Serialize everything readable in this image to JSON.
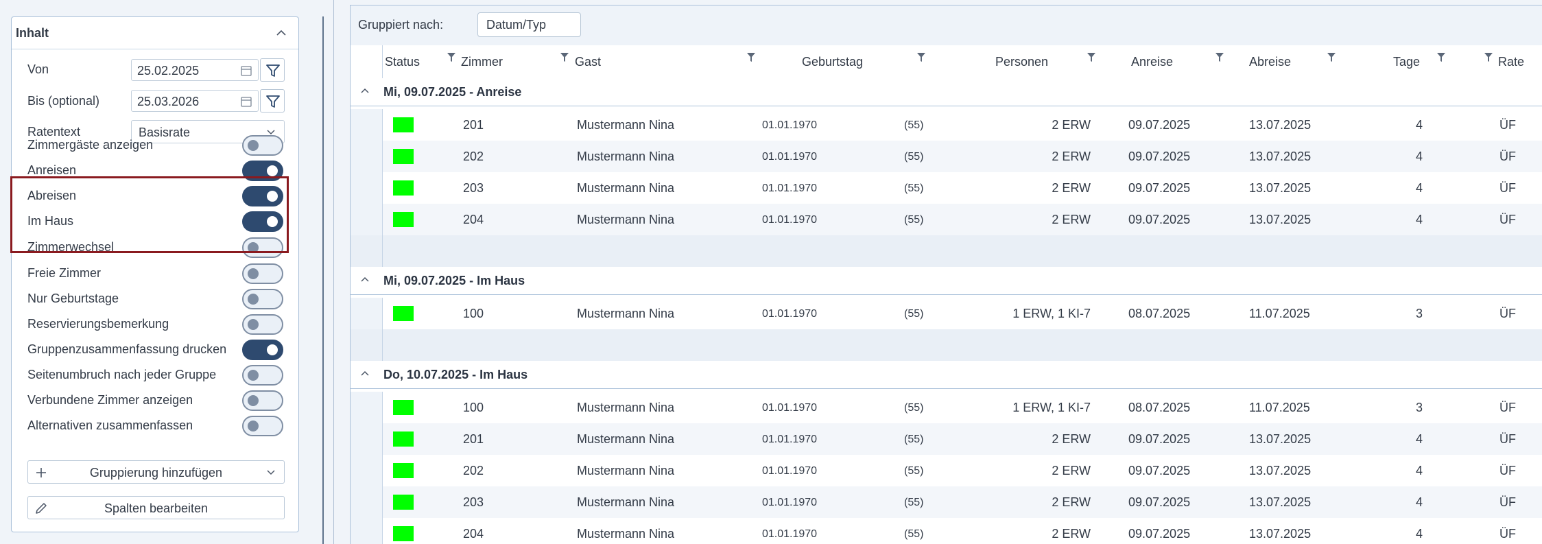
{
  "left_panel": {
    "title": "Inhalt",
    "von_label": "Von",
    "von_value": "25.02.2025",
    "bis_label": "Bis (optional)",
    "bis_value": "25.03.2026",
    "ratentext_label": "Ratentext",
    "ratentext_value": "Basisrate",
    "toggles": [
      {
        "label": "Zimmergäste anzeigen",
        "on": false
      },
      {
        "label": "Anreisen",
        "on": true
      },
      {
        "label": "Abreisen",
        "on": true
      },
      {
        "label": "Im Haus",
        "on": true
      },
      {
        "label": "Zimmerwechsel",
        "on": false
      },
      {
        "label": "Freie Zimmer",
        "on": false
      },
      {
        "label": "Nur Geburtstage",
        "on": false
      },
      {
        "label": "Reservierungsbemerkung",
        "on": false
      },
      {
        "label": "Gruppenzusammenfassung drucken",
        "on": true
      },
      {
        "label": "Seitenumbruch nach jeder Gruppe",
        "on": false
      },
      {
        "label": "Verbundene Zimmer anzeigen",
        "on": false
      },
      {
        "label": "Alternativen zusammenfassen",
        "on": false
      }
    ],
    "add_grouping_label": "Gruppierung hinzufügen",
    "edit_columns_label": "Spalten bearbeiten"
  },
  "grid": {
    "group_by_label": "Gruppiert nach:",
    "group_by_value": "Datum/Typ",
    "columns": [
      "Status",
      "Zimmer",
      "Gast",
      "Geburtstag",
      "Personen",
      "Anreise",
      "Abreise",
      "Tage",
      "Rate"
    ],
    "status_color": "#00ff00",
    "groups": [
      {
        "title": "Mi, 09.07.2025 - Anreise",
        "rows": [
          {
            "zimmer": "201",
            "gast": "Mustermann Nina",
            "geburtstag": "01.01.1970",
            "alter": "(55)",
            "personen": "2 ERW",
            "anreise": "09.07.2025",
            "abreise": "13.07.2025",
            "tage": "4",
            "rate": "ÜF"
          },
          {
            "zimmer": "202",
            "gast": "Mustermann Nina",
            "geburtstag": "01.01.1970",
            "alter": "(55)",
            "personen": "2 ERW",
            "anreise": "09.07.2025",
            "abreise": "13.07.2025",
            "tage": "4",
            "rate": "ÜF"
          },
          {
            "zimmer": "203",
            "gast": "Mustermann Nina",
            "geburtstag": "01.01.1970",
            "alter": "(55)",
            "personen": "2 ERW",
            "anreise": "09.07.2025",
            "abreise": "13.07.2025",
            "tage": "4",
            "rate": "ÜF"
          },
          {
            "zimmer": "204",
            "gast": "Mustermann Nina",
            "geburtstag": "01.01.1970",
            "alter": "(55)",
            "personen": "2 ERW",
            "anreise": "09.07.2025",
            "abreise": "13.07.2025",
            "tage": "4",
            "rate": "ÜF"
          }
        ]
      },
      {
        "title": "Mi, 09.07.2025 - Im Haus",
        "rows": [
          {
            "zimmer": "100",
            "gast": "Mustermann Nina",
            "geburtstag": "01.01.1970",
            "alter": "(55)",
            "personen": "1 ERW, 1 KI-7",
            "anreise": "08.07.2025",
            "abreise": "11.07.2025",
            "tage": "3",
            "rate": "ÜF"
          }
        ]
      },
      {
        "title": "Do, 10.07.2025 - Im Haus",
        "rows": [
          {
            "zimmer": "100",
            "gast": "Mustermann Nina",
            "geburtstag": "01.01.1970",
            "alter": "(55)",
            "personen": "1 ERW, 1 KI-7",
            "anreise": "08.07.2025",
            "abreise": "11.07.2025",
            "tage": "3",
            "rate": "ÜF"
          },
          {
            "zimmer": "201",
            "gast": "Mustermann Nina",
            "geburtstag": "01.01.1970",
            "alter": "(55)",
            "personen": "2 ERW",
            "anreise": "09.07.2025",
            "abreise": "13.07.2025",
            "tage": "4",
            "rate": "ÜF"
          },
          {
            "zimmer": "202",
            "gast": "Mustermann Nina",
            "geburtstag": "01.01.1970",
            "alter": "(55)",
            "personen": "2 ERW",
            "anreise": "09.07.2025",
            "abreise": "13.07.2025",
            "tage": "4",
            "rate": "ÜF"
          },
          {
            "zimmer": "203",
            "gast": "Mustermann Nina",
            "geburtstag": "01.01.1970",
            "alter": "(55)",
            "personen": "2 ERW",
            "anreise": "09.07.2025",
            "abreise": "13.07.2025",
            "tage": "4",
            "rate": "ÜF"
          },
          {
            "zimmer": "204",
            "gast": "Mustermann Nina",
            "geburtstag": "01.01.1970",
            "alter": "(55)",
            "personen": "2 ERW",
            "anreise": "09.07.2025",
            "abreise": "13.07.2025",
            "tage": "4",
            "rate": "ÜF"
          }
        ]
      }
    ]
  }
}
